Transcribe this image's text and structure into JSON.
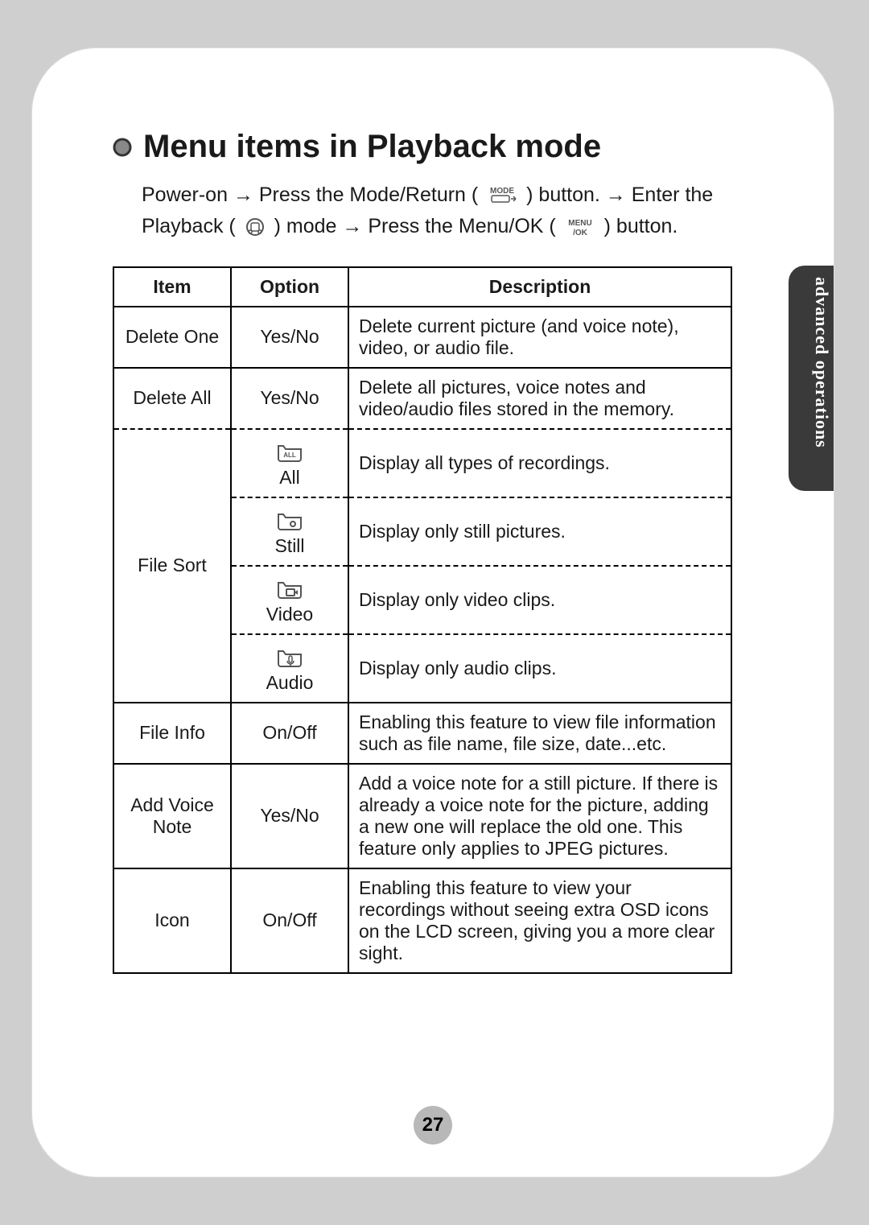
{
  "side_tab": "advanced operations",
  "heading": "Menu items in Playback mode",
  "intro": {
    "p1a": "Power-on → Press the Mode/Return (",
    "p1b": ") button. → Enter the Playback (",
    "p1c": ") mode → Press the Menu/OK (",
    "p1d": ") button."
  },
  "icons": {
    "mode_return_top": "MODE",
    "menu_ok_top": "MENU",
    "menu_ok_bottom": "/OK"
  },
  "table": {
    "headers": {
      "item": "Item",
      "option": "Option",
      "description": "Description"
    },
    "rows": [
      {
        "item": "Delete One",
        "option": "Yes/No",
        "description": "Delete current picture (and voice note), video, or audio file."
      },
      {
        "item": "Delete All",
        "option": "Yes/No",
        "description": "Delete all pictures, voice notes and video/audio files stored in the memory."
      },
      {
        "item": "File Sort",
        "option": "All",
        "description": "Display all types of recordings."
      },
      {
        "item": "",
        "option": "Still",
        "description": "Display only still pictures."
      },
      {
        "item": "",
        "option": "Video",
        "description": "Display only video clips."
      },
      {
        "item": "",
        "option": "Audio",
        "description": "Display only audio clips."
      },
      {
        "item": "File Info",
        "option": "On/Off",
        "description": "Enabling this feature to view file information such as file name, file size, date...etc."
      },
      {
        "item": "Add Voice Note",
        "option": "Yes/No",
        "description": "Add a voice note for a still picture. If there is already a voice note for the picture, adding a new one will replace the old one. This feature only applies to JPEG pictures."
      },
      {
        "item": "Icon",
        "option": "On/Off",
        "description": "Enabling this feature to view your recordings without seeing extra OSD icons on the LCD screen, giving you a more clear sight."
      }
    ]
  },
  "page_number": "27"
}
